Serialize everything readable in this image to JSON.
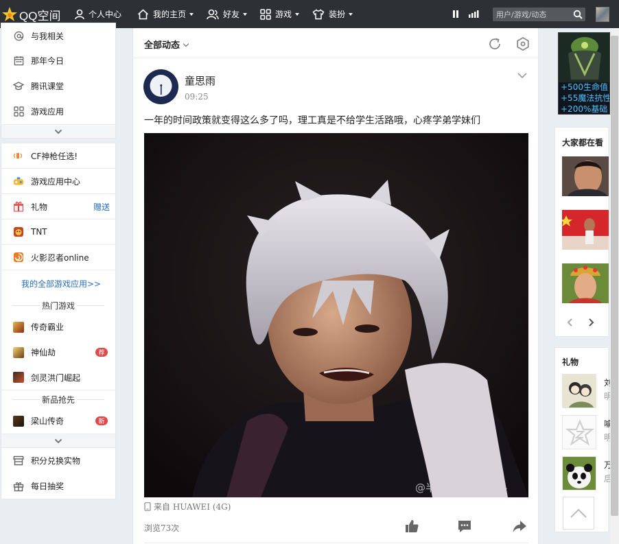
{
  "topbar": {
    "logo_text": "QQ空间",
    "nav": [
      {
        "label": "个人中心"
      },
      {
        "label": "我的主页"
      },
      {
        "label": "好友"
      },
      {
        "label": "游戏"
      },
      {
        "label": "装扮"
      }
    ],
    "search_placeholder": "用户/游戏/动态"
  },
  "sidebar": {
    "top_items": [
      {
        "label": "与我相关",
        "icon": "at-icon"
      },
      {
        "label": "那年今日",
        "icon": "calendar-icon"
      },
      {
        "label": "腾讯课堂",
        "icon": "graduation-cap-icon"
      },
      {
        "label": "游戏应用",
        "icon": "grid-icon"
      }
    ],
    "apps": [
      {
        "label": "CF神枪任选!",
        "icon": "speaker-icon"
      },
      {
        "label": "游戏应用中心",
        "icon": "game-center-icon"
      },
      {
        "label": "礼物",
        "icon": "gift-icon",
        "extra": "赠送"
      },
      {
        "label": "TNT",
        "icon": "tnt-icon"
      },
      {
        "label": "火影忍者online",
        "icon": "naruto-icon"
      }
    ],
    "all_games_link": "我的全部游戏应用>>",
    "hot_games_title": "热门游戏",
    "hot_games": [
      {
        "label": "传奇霸业",
        "badge": ""
      },
      {
        "label": "神仙劫",
        "badge": "荐"
      },
      {
        "label": "剑灵洪门崛起",
        "badge": ""
      }
    ],
    "new_games_title": "新品抢先",
    "new_games": [
      {
        "label": "梁山传奇",
        "badge": "新"
      }
    ],
    "bottom_items": [
      {
        "label": "积分兑换实物",
        "icon": "store-icon"
      },
      {
        "label": "每日抽奖",
        "icon": "gift-box-icon"
      }
    ]
  },
  "feed": {
    "title": "全部动态",
    "post": {
      "author": "童思雨",
      "time": "09:25",
      "text": "一年的时间政策就变得这么多了吗，理工真是不给学生活路哦，心疼学弟学妹们",
      "source": "来自 HUAWEI (4G)",
      "views": "浏览73次",
      "watermark": "@半撩米 | 英语杰斗"
    }
  },
  "right": {
    "ad_lines": [
      "+500生命值",
      "+55魔法抗性",
      "+200%基础"
    ],
    "watching_title": "大家都在看",
    "gifts_title": "礼物",
    "gifts": [
      {
        "name": "刘",
        "sub": "明"
      },
      {
        "name": "喻",
        "sub": "明"
      },
      {
        "name": "万",
        "sub": "后"
      }
    ]
  },
  "colors": {
    "topbar": "#2d3034",
    "link": "#2b6fbd",
    "badge": "#e0494b",
    "background": "#e9eef3"
  }
}
